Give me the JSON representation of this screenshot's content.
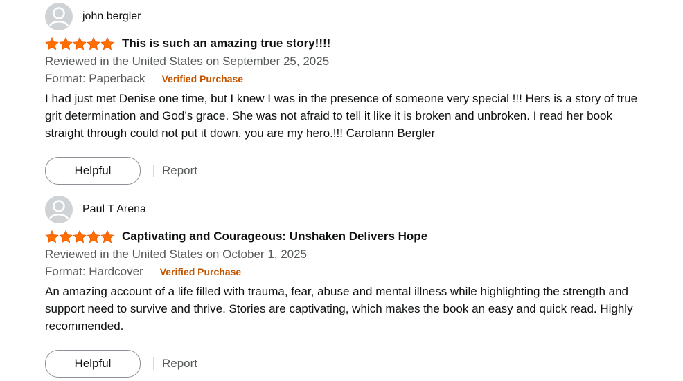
{
  "reviews": [
    {
      "profile_name": "john bergler",
      "rating": 5,
      "title": "This is such an amazing true story!!!!",
      "date": "Reviewed in the United States on September 25, 2025",
      "format": "Format: Paperback",
      "verified": "Verified Purchase",
      "body": "I had just met Denise one time, but I knew I was in the presence of someone very special !!! Hers is a story of true grit determination and God’s grace. She was not afraid to tell it like it is broken and unbroken. I read her book straight through could not put it down. you are my hero.!!! Carolann Bergler",
      "helpful_label": "Helpful",
      "report_label": "Report"
    },
    {
      "profile_name": "Paul T Arena",
      "rating": 5,
      "title": "Captivating and Courageous: Unshaken Delivers Hope",
      "date": "Reviewed in the United States on October 1, 2025",
      "format": "Format: Hardcover",
      "verified": "Verified Purchase",
      "body": "An amazing account of a life filled with trauma, fear, abuse and mental illness while highlighting the strength and support need to survive and thrive. Stories are captivating, which makes the book an easy and quick read. Highly recommended.",
      "helpful_label": "Helpful",
      "report_label": "Report"
    }
  ],
  "colors": {
    "star": "#ff6f00",
    "verified": "#c45500",
    "secondary_text": "#565959"
  },
  "icons": {
    "avatar": "default-avatar-icon",
    "star": "star-icon"
  }
}
